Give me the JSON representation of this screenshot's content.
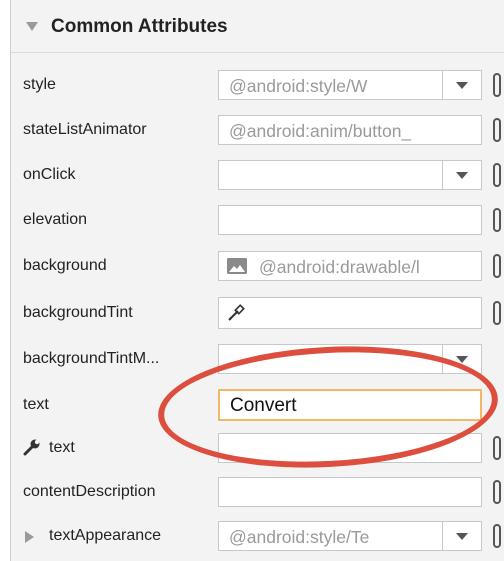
{
  "section_title": "Common Attributes",
  "rows": [
    {
      "label": "style",
      "value": "@android:style/W",
      "dropdown": true
    },
    {
      "label": "stateListAnimator",
      "value": "@android:anim/button_",
      "dropdown": false
    },
    {
      "label": "onClick",
      "value": "",
      "dropdown": true
    },
    {
      "label": "elevation",
      "value": "",
      "dropdown": false
    },
    {
      "label": "background",
      "value": "@android:drawable/l",
      "dropdown": false
    },
    {
      "label": "backgroundTint",
      "value": "",
      "dropdown": false
    },
    {
      "label": "backgroundTintM...",
      "value": "",
      "dropdown": true
    },
    {
      "label": "text",
      "value": "Convert",
      "dropdown": false
    },
    {
      "label": "text",
      "value": "",
      "dropdown": false
    },
    {
      "label": "contentDescription",
      "value": "",
      "dropdown": false
    },
    {
      "label": "textAppearance",
      "value": "@android:style/Te",
      "dropdown": true
    }
  ],
  "colors": {
    "highlight_ellipse": "#dd4e3f",
    "focus_border": "#f3b866",
    "panel_background": "#f3f3f3"
  },
  "icons": {
    "collapse": "triangle-down-icon",
    "wrench": "wrench-icon",
    "expand": "triangle-right-icon",
    "image": "image-icon",
    "eyedropper": "eyedropper-icon"
  }
}
